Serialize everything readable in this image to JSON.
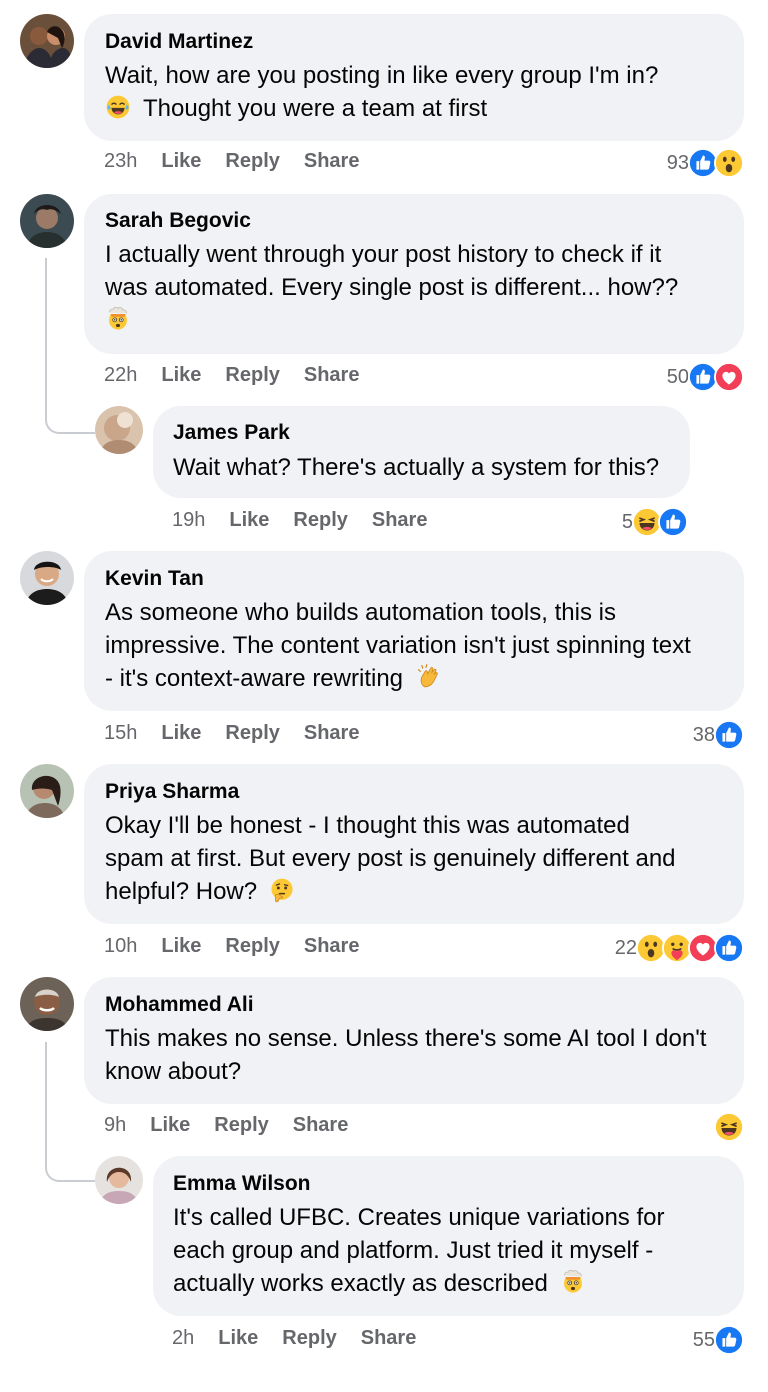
{
  "comments": [
    {
      "author": "David Martinez",
      "lines": [
        "Wait, how are you posting in like every group I'm in?",
        "Thought you were a team at first"
      ],
      "time": "23h",
      "like": "Like",
      "reply": "Reply",
      "share": "Share",
      "reaction_count": "93",
      "reactions": [
        "like-reaction",
        "wow-reaction"
      ]
    },
    {
      "author": "Sarah Begovic",
      "lines": [
        "I actually went through your post history to check if it",
        "was automated. Every single post is different... how??"
      ],
      "time": "22h",
      "like": "Like",
      "reply": "Reply",
      "share": "Share",
      "reaction_count": "50",
      "reactions": [
        "like-reaction",
        "love-reaction"
      ]
    },
    {
      "author": "James Park",
      "lines": [
        "Wait what? There's actually a system for this?"
      ],
      "time": "19h",
      "like": "Like",
      "reply": "Reply",
      "share": "Share",
      "reaction_count": "5",
      "reactions": [
        "haha-reaction",
        "like-reaction"
      ]
    },
    {
      "author": "Kevin Tan",
      "lines": [
        "As someone who builds automation tools, this is",
        "impressive. The content variation isn't just spinning text",
        "- it's context-aware rewriting"
      ],
      "time": "15h",
      "like": "Like",
      "reply": "Reply",
      "share": "Share",
      "reaction_count": "38",
      "reactions": [
        "like-reaction"
      ]
    },
    {
      "author": "Priya Sharma",
      "lines": [
        "Okay I'll be honest - I thought this was automated",
        "spam at first. But every post is genuinely different and",
        "helpful? How?"
      ],
      "time": "10h",
      "like": "Like",
      "reply": "Reply",
      "share": "Share",
      "reaction_count": "22",
      "reactions": [
        "wow-reaction",
        "care-reaction",
        "love-reaction",
        "like-reaction"
      ]
    },
    {
      "author": "Mohammed Ali",
      "lines": [
        "This makes no sense. Unless there's some AI tool I don't",
        "know about?"
      ],
      "time": "9h",
      "like": "Like",
      "reply": "Reply",
      "share": "Share",
      "reaction_count": "",
      "reactions": [
        "haha-reaction"
      ]
    },
    {
      "author": "Emma Wilson",
      "lines": [
        "It's called UFBC. Creates unique variations for",
        "each group and platform. Just tried it myself -",
        "actually works exactly as described"
      ],
      "time": "2h",
      "like": "Like",
      "reply": "Reply",
      "share": "Share",
      "reaction_count": "55",
      "reactions": [
        "like-reaction"
      ]
    }
  ],
  "colors": {
    "bubble": "#f0f2f5",
    "meta_text": "#65676b",
    "like_blue": "#1877f2",
    "love_red": "#f33e58",
    "emoji_yellow": "#fcc934"
  }
}
